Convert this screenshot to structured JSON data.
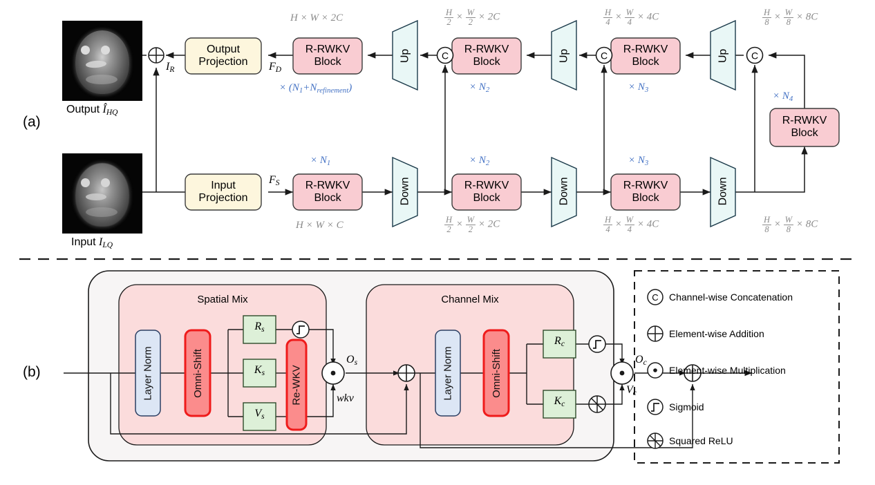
{
  "figure": {
    "panels": [
      {
        "id": "a",
        "label": "(a)"
      },
      {
        "id": "b",
        "label": "(b)"
      }
    ]
  },
  "colors": {
    "rwkv_block_fill": "#f9ccd2",
    "rwkv_block_stroke": "#3b3b3b",
    "projection_fill": "#fdf6dd",
    "projection_stroke": "#3b3b3b",
    "sampler_fill": "#e9f7f6",
    "sampler_stroke": "#1b3a4a",
    "layernorm_fill": "#dce6f5",
    "layernorm_stroke": "#2b3f63",
    "omnishift_fill": "#fb8c8c",
    "omnishift_stroke": "#ef1b1b",
    "rewkv_fill": "#fb8c8c",
    "rewkv_stroke": "#ef1b1b",
    "rkv_fill": "#ddf0d8",
    "rkv_stroke": "#2d4a2a",
    "mix_fill": "#fbdcdc",
    "block_bg": "#f7f5f5",
    "mult_text": "#4472c4",
    "dim_text": "#8c8c8c",
    "line": "#1a1a1a"
  },
  "panel_a": {
    "images": [
      {
        "name": "output-mri",
        "caption_prefix": "Output",
        "caption_symbol": "Î",
        "caption_sub": "HQ"
      },
      {
        "name": "input-mri",
        "caption_prefix": "Input",
        "caption_symbol": "I",
        "caption_sub": "LQ"
      }
    ],
    "projections": [
      {
        "name": "output-projection",
        "line1": "Output",
        "line2": "Projection"
      },
      {
        "name": "input-projection",
        "line1": "Input",
        "line2": "Projection"
      }
    ],
    "block_label": {
      "line1": "R-RWKV",
      "line2": "Block"
    },
    "samplers": {
      "up": "Up",
      "down": "Down"
    },
    "concat_symbol": "C",
    "feature_labels": {
      "residual": "I_R",
      "decoder": "F_D",
      "shallow": "F_S"
    },
    "decoder_blocks": [
      {
        "name": "decoder-block-level1",
        "mult": "× (N₁+N_refinement)",
        "dim_top": "H × W × 2C"
      },
      {
        "name": "decoder-block-level2",
        "mult": "× N₂",
        "dim_top": "H/2 × W/2 × 2C"
      },
      {
        "name": "decoder-block-level3",
        "mult": "× N₃",
        "dim_top": "H/4 × W/4 × 4C"
      }
    ],
    "encoder_blocks": [
      {
        "name": "encoder-block-level1",
        "mult": "× N₁",
        "dim_bottom": "H × W × C"
      },
      {
        "name": "encoder-block-level2",
        "mult": "× N₂",
        "dim_bottom": "H/2 × W/2 × 2C"
      },
      {
        "name": "encoder-block-level3",
        "mult": "× N₃",
        "dim_bottom": "H/4 × W/4 × 4C"
      }
    ],
    "latent_block": {
      "name": "latent-block-level4",
      "mult": "× N₄",
      "dim_top": "H/8 × W/8 × 8C",
      "dim_bottom": "H/8 × W/8 × 8C"
    }
  },
  "panel_b": {
    "spatial_mix": {
      "title": "Spatial Mix",
      "layer_norm": "Layer Norm",
      "omni_shift": "Omni-Shift",
      "gates": [
        {
          "label": "R",
          "sub": "s"
        },
        {
          "label": "K",
          "sub": "s"
        },
        {
          "label": "V",
          "sub": "s"
        }
      ],
      "rewkv": "Re-WKV",
      "output_label": "O_s",
      "wkv_label": "wkv"
    },
    "channel_mix": {
      "title": "Channel Mix",
      "layer_norm": "Layer Norm",
      "omni_shift": "Omni-Shift",
      "gates": [
        {
          "label": "R",
          "sub": "c"
        },
        {
          "label": "K",
          "sub": "c"
        }
      ],
      "output_label": "O_c",
      "value_label": "V_c"
    }
  },
  "legend": {
    "items": [
      {
        "icon": "circle-c-icon",
        "text": "Channel-wise Concatenation"
      },
      {
        "icon": "circle-plus-icon",
        "text": "Element-wise Addition"
      },
      {
        "icon": "circle-dot-icon",
        "text": "Element-wise Multiplication"
      },
      {
        "icon": "circle-sigmoid-icon",
        "text": "Sigmoid"
      },
      {
        "icon": "circle-squared-relu-icon",
        "text": "Squared ReLU"
      }
    ]
  }
}
